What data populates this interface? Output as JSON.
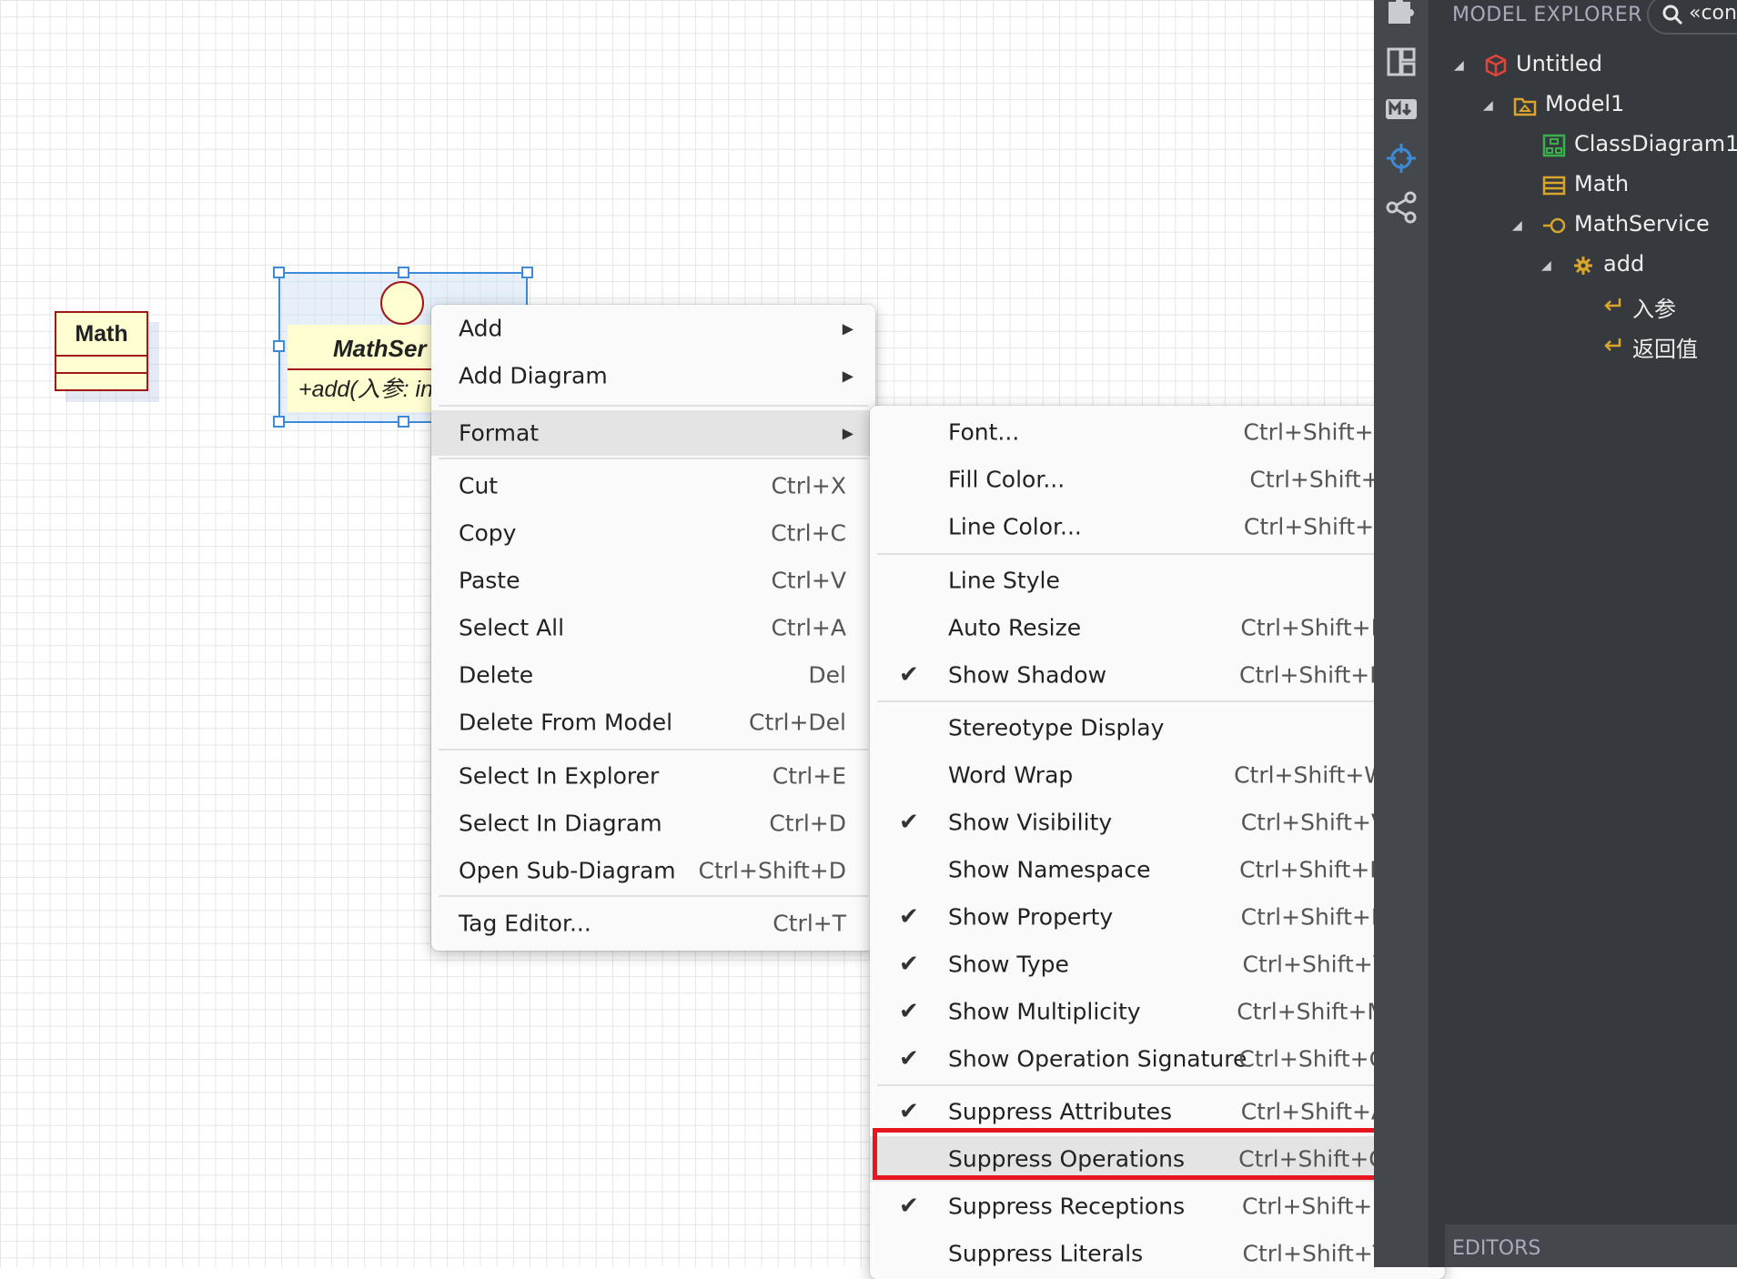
{
  "diagram": {
    "math_class": {
      "name": "Math"
    },
    "service_interface": {
      "name": "MathService",
      "visible_name": "MathSer",
      "operation": "+add(入参: i",
      "visible_operation": "+add(入参: in"
    }
  },
  "context_menu": {
    "items": [
      {
        "label": "Add",
        "shortcut": "",
        "submenu": true
      },
      {
        "label": "Add Diagram",
        "shortcut": "",
        "submenu": true
      },
      {
        "label": "Format",
        "shortcut": "",
        "submenu": true,
        "highlighted": true
      },
      {
        "label": "Cut",
        "shortcut": "Ctrl+X"
      },
      {
        "label": "Copy",
        "shortcut": "Ctrl+C"
      },
      {
        "label": "Paste",
        "shortcut": "Ctrl+V"
      },
      {
        "label": "Select All",
        "shortcut": "Ctrl+A"
      },
      {
        "label": "Delete",
        "shortcut": "Del"
      },
      {
        "label": "Delete From Model",
        "shortcut": "Ctrl+Del"
      },
      {
        "label": "Select In Explorer",
        "shortcut": "Ctrl+E"
      },
      {
        "label": "Select In Diagram",
        "shortcut": "Ctrl+D"
      },
      {
        "label": "Open Sub-Diagram",
        "shortcut": "Ctrl+Shift+D"
      },
      {
        "label": "Tag Editor...",
        "shortcut": "Ctrl+T"
      }
    ]
  },
  "format_submenu": {
    "items": [
      {
        "label": "Font...",
        "shortcut": "Ctrl+Shift+F",
        "checked": false
      },
      {
        "label": "Fill Color...",
        "shortcut": "Ctrl+Shift+I",
        "checked": false
      },
      {
        "label": "Line Color...",
        "shortcut": "Ctrl+Shift+L",
        "checked": false
      },
      {
        "label": "Line Style",
        "shortcut": "",
        "submenu": true,
        "checked": false
      },
      {
        "label": "Auto Resize",
        "shortcut": "Ctrl+Shift+R",
        "checked": false
      },
      {
        "label": "Show Shadow",
        "shortcut": "Ctrl+Shift+H",
        "checked": true
      },
      {
        "label": "Stereotype Display",
        "shortcut": "",
        "submenu": true,
        "checked": false
      },
      {
        "label": "Word Wrap",
        "shortcut": "Ctrl+Shift+W",
        "checked": false
      },
      {
        "label": "Show Visibility",
        "shortcut": "Ctrl+Shift+V",
        "checked": true
      },
      {
        "label": "Show Namespace",
        "shortcut": "Ctrl+Shift+N",
        "checked": false
      },
      {
        "label": "Show Property",
        "shortcut": "Ctrl+Shift+B",
        "checked": true
      },
      {
        "label": "Show Type",
        "shortcut": "Ctrl+Shift+Y",
        "checked": true
      },
      {
        "label": "Show Multiplicity",
        "shortcut": "Ctrl+Shift+M",
        "checked": true
      },
      {
        "label": "Show Operation Signature",
        "shortcut": "Ctrl+Shift+G",
        "checked": true
      },
      {
        "label": "Suppress Attributes",
        "shortcut": "Ctrl+Shift+A",
        "checked": true
      },
      {
        "label": "Suppress Operations",
        "shortcut": "Ctrl+Shift+O",
        "checked": false,
        "highlighted": true
      },
      {
        "label": "Suppress Receptions",
        "shortcut": "Ctrl+Shift+E",
        "checked": true
      },
      {
        "label": "Suppress Literals",
        "shortcut": "Ctrl+Shift+T",
        "checked": false
      }
    ],
    "check_glyph": "✔",
    "arrow_glyph": "▶"
  },
  "explorer": {
    "title": "MODEL EXPLORER",
    "search_text": "«con",
    "tree": [
      {
        "label": "Untitled",
        "icon": "project-icon"
      },
      {
        "label": "Model1",
        "icon": "model-icon"
      },
      {
        "label": "ClassDiagram1",
        "icon": "class-diagram-icon"
      },
      {
        "label": "Math",
        "icon": "class-icon"
      },
      {
        "label": "MathService",
        "icon": "interface-icon"
      },
      {
        "label": "add",
        "icon": "operation-icon"
      },
      {
        "label": "入参",
        "icon": "parameter-icon"
      },
      {
        "label": "返回值",
        "icon": "parameter-icon"
      }
    ]
  },
  "editors": {
    "label": "EDITORS"
  },
  "colors": {
    "uml_fill": "#fffed0",
    "uml_border": "#a01818",
    "selection": "#3d8bd8",
    "highlight_box": "#e8141e",
    "panel_bg": "#363a3e",
    "toolbar_bg": "#44484c"
  }
}
